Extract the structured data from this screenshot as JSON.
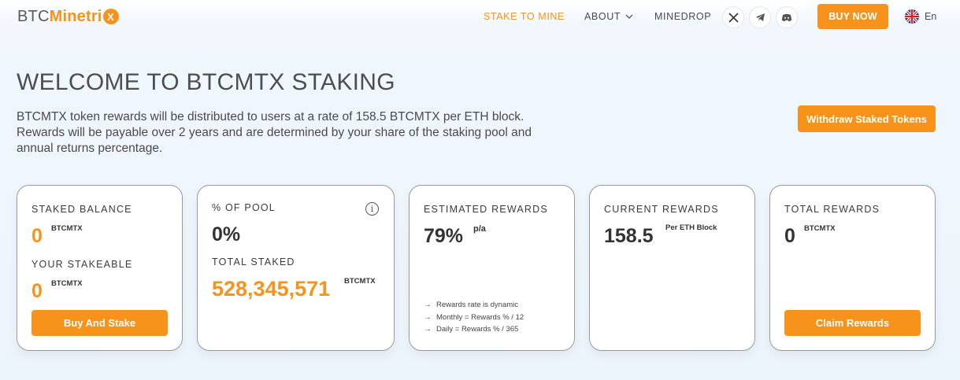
{
  "logo": {
    "part1": "BTC",
    "part2": "Minetri",
    "badge": "X"
  },
  "nav": {
    "stake": "STAKE TO MINE",
    "about": "ABOUT",
    "minedrop": "MINEDROP",
    "social": [
      "x-icon",
      "telegram-icon",
      "discord-icon"
    ],
    "buy_now": "BUY NOW",
    "lang": "En"
  },
  "hero": {
    "title": "WELCOME TO BTCMTX STAKING",
    "intro": "BTCMTX token rewards will be distributed to users at a rate of 158.5 BTCMTX per ETH block. Rewards will be payable over 2 years and are determined by your share of the staking pool and annual returns percentage.",
    "withdraw": "Withdraw Staked Tokens"
  },
  "cards": {
    "staked": {
      "label": "STAKED BALANCE",
      "value": "0",
      "unit": "BTCMTX",
      "label2": "YOUR STAKEABLE",
      "value2": "0",
      "unit2": "BTCMTX",
      "button": "Buy And Stake"
    },
    "pool": {
      "label": "% OF POOL",
      "value": "0%",
      "info": "i",
      "label2": "TOTAL STAKED",
      "value2": "528,345,571",
      "unit2": "BTCMTX"
    },
    "estimated": {
      "label": "ESTIMATED REWARDS",
      "value": "79%",
      "unit": "p/a",
      "notes": [
        "Rewards rate is dynamic",
        "Monthly = Rewards % / 12",
        "Daily = Rewards % / 365"
      ]
    },
    "current": {
      "label": "CURRENT REWARDS",
      "value": "158.5",
      "unit": "Per ETH Block"
    },
    "total": {
      "label": "TOTAL REWARDS",
      "value": "0",
      "unit": "BTCMTX",
      "button": "Claim Rewards"
    }
  },
  "colors": {
    "accent": "#f7931a",
    "text": "#3b3b3b",
    "background": "#eef5fc"
  }
}
